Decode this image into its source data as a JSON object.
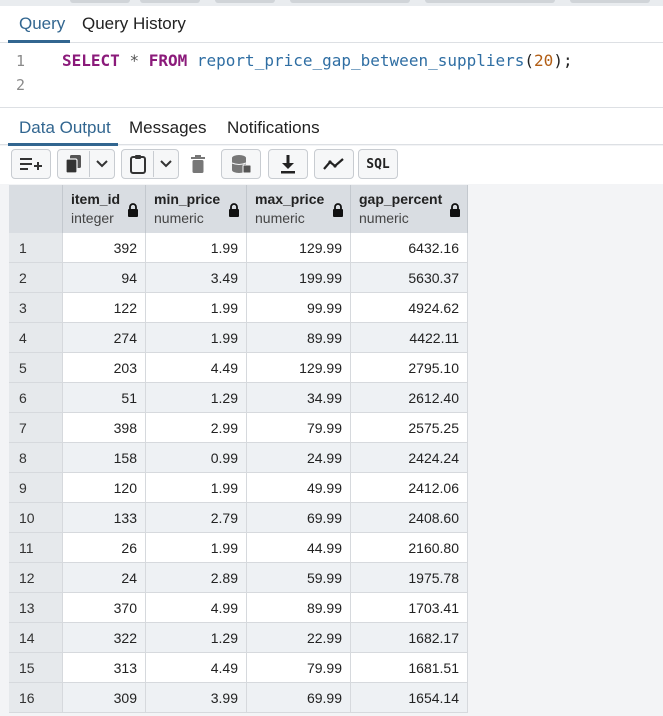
{
  "query_tabs": [
    "Query",
    "Query History"
  ],
  "editor": {
    "line_numbers": [
      "1",
      "2"
    ],
    "code": {
      "select": "SELECT",
      "star": "*",
      "from": "FROM",
      "fn": "report_price_gap_between_suppliers",
      "open": "(",
      "arg": "20",
      "close": ");"
    }
  },
  "result_tabs": [
    "Data Output",
    "Messages",
    "Notifications"
  ],
  "toolbar": {
    "buttons": [
      "add-row-icon",
      "copy-icon",
      "dropdown-icon",
      "paste-icon",
      "dropdown-icon",
      "delete-icon",
      "save-data-icon",
      "download-icon",
      "graph-icon",
      "sql-icon"
    ],
    "sql_label": "SQL"
  },
  "columns": [
    {
      "name": "item_id",
      "type": "integer"
    },
    {
      "name": "min_price",
      "type": "numeric"
    },
    {
      "name": "max_price",
      "type": "numeric"
    },
    {
      "name": "gap_percent",
      "type": "numeric"
    }
  ],
  "rows": [
    [
      "1",
      "392",
      "1.99",
      "129.99",
      "6432.16"
    ],
    [
      "2",
      "94",
      "3.49",
      "199.99",
      "5630.37"
    ],
    [
      "3",
      "122",
      "1.99",
      "99.99",
      "4924.62"
    ],
    [
      "4",
      "274",
      "1.99",
      "89.99",
      "4422.11"
    ],
    [
      "5",
      "203",
      "4.49",
      "129.99",
      "2795.10"
    ],
    [
      "6",
      "51",
      "1.29",
      "34.99",
      "2612.40"
    ],
    [
      "7",
      "398",
      "2.99",
      "79.99",
      "2575.25"
    ],
    [
      "8",
      "158",
      "0.99",
      "24.99",
      "2424.24"
    ],
    [
      "9",
      "120",
      "1.99",
      "49.99",
      "2412.06"
    ],
    [
      "10",
      "133",
      "2.79",
      "69.99",
      "2408.60"
    ],
    [
      "11",
      "26",
      "1.99",
      "44.99",
      "2160.80"
    ],
    [
      "12",
      "24",
      "2.89",
      "59.99",
      "1975.78"
    ],
    [
      "13",
      "370",
      "4.99",
      "89.99",
      "1703.41"
    ],
    [
      "14",
      "322",
      "1.29",
      "22.99",
      "1682.17"
    ],
    [
      "15",
      "313",
      "4.49",
      "79.99",
      "1681.51"
    ],
    [
      "16",
      "309",
      "3.99",
      "69.99",
      "1654.14"
    ]
  ]
}
